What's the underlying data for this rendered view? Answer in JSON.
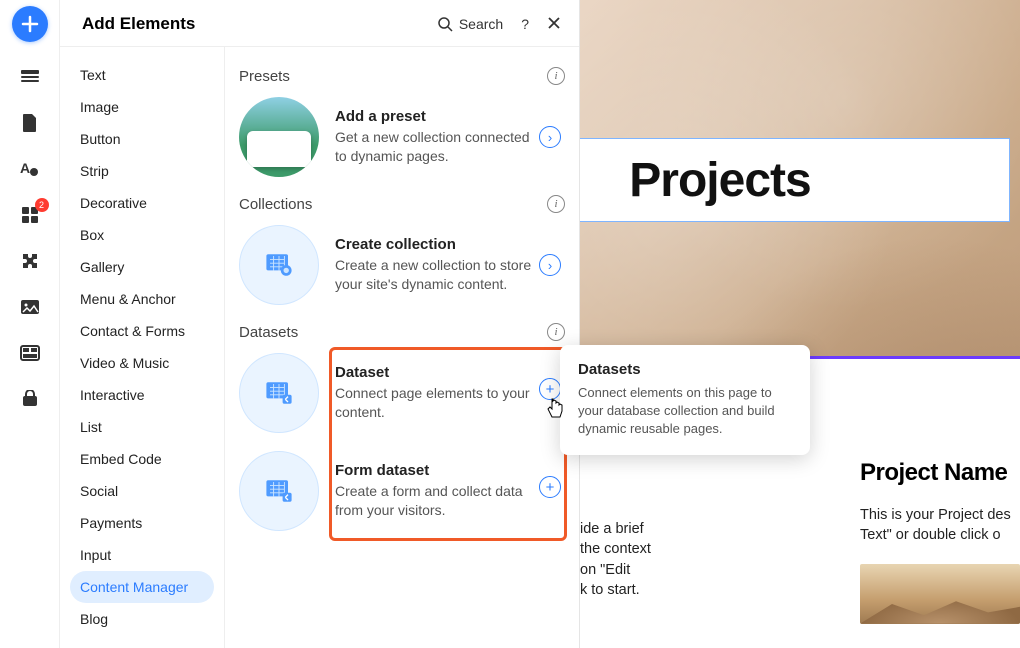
{
  "rail": {
    "badge": "2"
  },
  "panel": {
    "title": "Add Elements",
    "search_label": "Search"
  },
  "categories": [
    "Text",
    "Image",
    "Button",
    "Strip",
    "Decorative",
    "Box",
    "Gallery",
    "Menu & Anchor",
    "Contact & Forms",
    "Video & Music",
    "Interactive",
    "List",
    "Embed Code",
    "Social",
    "Payments",
    "Input",
    "Content Manager",
    "Blog"
  ],
  "active_category_index": 16,
  "sections": {
    "presets": {
      "title": "Presets",
      "card_title": "Add a preset",
      "card_desc": "Get a new collection connected to dynamic pages."
    },
    "collections": {
      "title": "Collections",
      "card_title": "Create collection",
      "card_desc": "Create a new collection to store your site's dynamic content."
    },
    "datasets": {
      "title": "Datasets",
      "dataset_title": "Dataset",
      "dataset_desc": "Connect page elements to your content.",
      "form_title": "Form dataset",
      "form_desc": "Create a form and collect data from your visitors."
    }
  },
  "tooltip": {
    "title": "Datasets",
    "desc": "Connect elements on this page to your database collection and build dynamic reusable pages."
  },
  "canvas": {
    "heading": "Projects",
    "project_left_desc_lines": "ide a brief\n the context\non \"Edit\nk to start.",
    "project_right_name": "Project Name",
    "project_right_desc": "This is your Project des\nText\" or double click o"
  }
}
